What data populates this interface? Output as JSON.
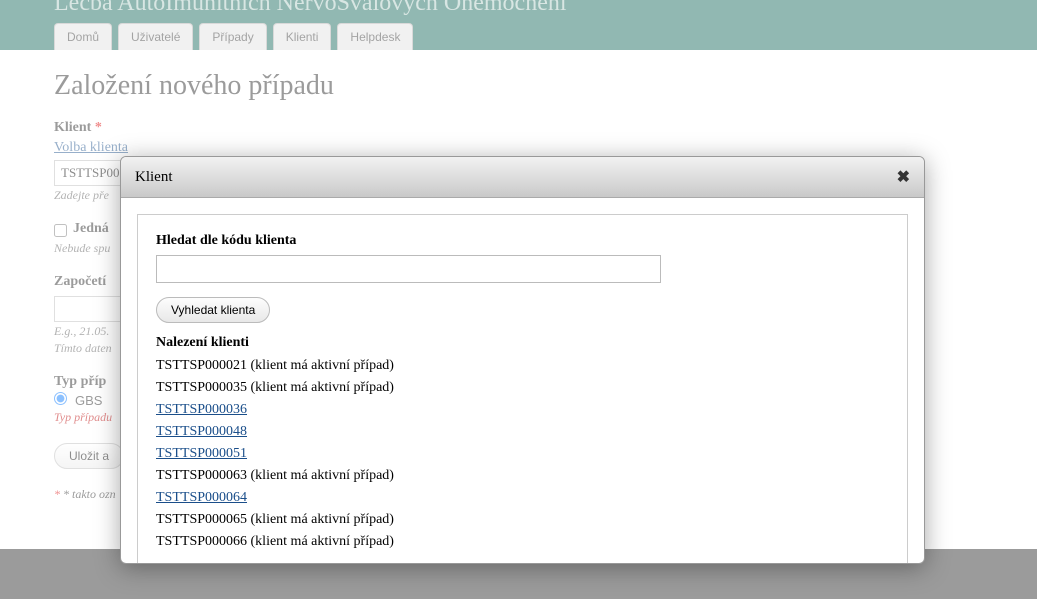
{
  "site_title": "Léčba AutoImunitních NervoSvalových Onemocnění",
  "nav": {
    "tabs": [
      "Domů",
      "Uživatelé",
      "Případy",
      "Klienti",
      "Helpdesk"
    ]
  },
  "page": {
    "title": "Založení nového případu",
    "client": {
      "label": "Klient",
      "required_mark": "*",
      "choose_link": "Volba klienta",
      "input_value": "TSTTSP00",
      "helper": "Zadejte pře"
    },
    "single": {
      "label": "Jedná",
      "helper": "Nebude spu"
    },
    "start": {
      "label": "Započetí",
      "example": "E.g., 21.05.",
      "helper": "Tímto daten"
    },
    "type": {
      "label": "Typ příp",
      "options": [
        "GBS"
      ],
      "error": "Typ případu"
    },
    "submit": "Uložit a",
    "footnote": "* takto ozn"
  },
  "dialog": {
    "title": "Klient",
    "search_label": "Hledat dle kódu klienta",
    "search_value": "",
    "search_button": "Vyhledat klienta",
    "results_label": "Nalezení klienti",
    "active_suffix": " (klient má aktivní případ)",
    "clients": [
      {
        "code": "TSTTSP000021",
        "active": true
      },
      {
        "code": "TSTTSP000035",
        "active": true
      },
      {
        "code": "TSTTSP000036",
        "active": false
      },
      {
        "code": "TSTTSP000048",
        "active": false
      },
      {
        "code": "TSTTSP000051",
        "active": false
      },
      {
        "code": "TSTTSP000063",
        "active": true
      },
      {
        "code": "TSTTSP000064",
        "active": false
      },
      {
        "code": "TSTTSP000065",
        "active": true
      },
      {
        "code": "TSTTSP000066",
        "active": true
      }
    ]
  }
}
